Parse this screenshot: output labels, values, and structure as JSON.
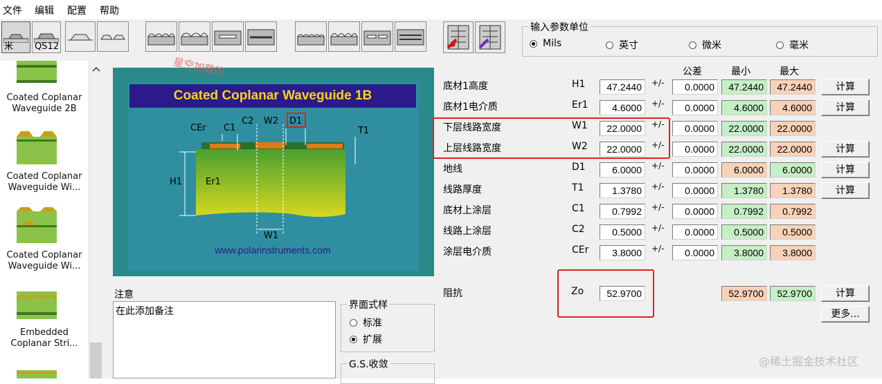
{
  "menu": {
    "file": "文件",
    "edit": "编辑",
    "config": "配置",
    "help": "帮助"
  },
  "toolbar": {
    "btn1_label": "米",
    "btn2_label": "QS12"
  },
  "units": {
    "title": "输入参数单位",
    "options": [
      "Mils",
      "英寸",
      "微米",
      "毫米"
    ],
    "selected": "Mils"
  },
  "sidebar": {
    "items": [
      {
        "label": "Coated Coplanar Waveguide 2B"
      },
      {
        "label": "Coated Coplanar Waveguide Wi..."
      },
      {
        "label": "Coated Coplanar Waveguide Wi..."
      },
      {
        "label": "Embedded Coplanar Stri..."
      }
    ]
  },
  "diagram": {
    "title": "Coated Coplanar Waveguide 1B",
    "url": "www.polarinstruments.com",
    "labels": {
      "cer": "CEr",
      "c1": "C1",
      "c2": "C2",
      "w2": "W2",
      "d1": "D1",
      "t1": "T1",
      "h1": "H1",
      "er1": "Er1",
      "w1": "W1"
    }
  },
  "overlay_watermark": "星空加载的",
  "columns": {
    "tolerance": "公差",
    "min": "最小",
    "max": "最大"
  },
  "params": [
    {
      "label": "底材1高度",
      "symbol": "H1",
      "value": "47.2440",
      "pm": "+/-",
      "tol": "0.0000",
      "min": "47.2440",
      "max": "47.2440",
      "min_color": "green",
      "max_color": "orange",
      "button": "计算"
    },
    {
      "label": "底材1电介质",
      "symbol": "Er1",
      "value": "4.6000",
      "pm": "+/-",
      "tol": "0.0000",
      "min": "4.6000",
      "max": "4.6000",
      "min_color": "green",
      "max_color": "orange",
      "button": "计算"
    },
    {
      "label": "下层线路宽度",
      "symbol": "W1",
      "value": "22.0000",
      "pm": "+/-",
      "tol": "0.0000",
      "min": "22.0000",
      "max": "22.0000",
      "min_color": "green",
      "max_color": "orange",
      "button": ""
    },
    {
      "label": "上层线路宽度",
      "symbol": "W2",
      "value": "22.0000",
      "pm": "+/-",
      "tol": "0.0000",
      "min": "22.0000",
      "max": "22.0000",
      "min_color": "green",
      "max_color": "orange",
      "button": "计算"
    },
    {
      "label": "地线",
      "symbol": "D1",
      "value": "6.0000",
      "pm": "+/-",
      "tol": "0.0000",
      "min": "6.0000",
      "max": "6.0000",
      "min_color": "orange",
      "max_color": "green",
      "button": "计算"
    },
    {
      "label": "线路厚度",
      "symbol": "T1",
      "value": "1.3780",
      "pm": "+/-",
      "tol": "0.0000",
      "min": "1.3780",
      "max": "1.3780",
      "min_color": "green",
      "max_color": "orange",
      "button": "计算"
    },
    {
      "label": "底材上涂层",
      "symbol": "C1",
      "value": "0.7992",
      "pm": "+/-",
      "tol": "0.0000",
      "min": "0.7992",
      "max": "0.7992",
      "min_color": "green",
      "max_color": "orange",
      "button": ""
    },
    {
      "label": "线路上涂层",
      "symbol": "C2",
      "value": "0.5000",
      "pm": "+/-",
      "tol": "0.0000",
      "min": "0.5000",
      "max": "0.5000",
      "min_color": "green",
      "max_color": "orange",
      "button": ""
    },
    {
      "label": "涂层电介质",
      "symbol": "CEr",
      "value": "3.8000",
      "pm": "+/-",
      "tol": "0.0000",
      "min": "3.8000",
      "max": "3.8000",
      "min_color": "green",
      "max_color": "orange",
      "button": ""
    }
  ],
  "impedance": {
    "label": "阻抗",
    "symbol": "Zo",
    "value": "52.9700",
    "min": "52.9700",
    "max": "52.9700",
    "button": "计算",
    "more": "更多..."
  },
  "notes": {
    "label": "注意",
    "text": "在此添加备注"
  },
  "style_group": {
    "title": "界面式样",
    "options": [
      "标准",
      "扩展"
    ],
    "selected": "扩展"
  },
  "gs_group": {
    "title": "G.S.收敛"
  },
  "watermark": "@稀土掘金技术社区",
  "colors": {
    "green_cell": "#c6efc6",
    "orange_cell": "#f8d2b8",
    "highlight_red": "#e0201e",
    "diagram_bg": "#2a8a8a",
    "diagram_title_bg": "#2a1a8a",
    "diagram_title_fg": "#ffd21a"
  }
}
